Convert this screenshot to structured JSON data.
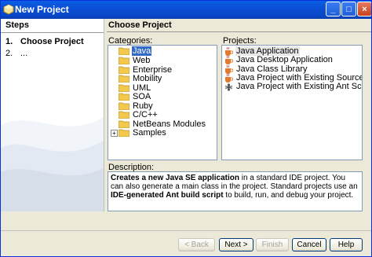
{
  "window": {
    "title": "New Project"
  },
  "steps": {
    "heading": "Steps",
    "items": [
      {
        "num": "1.",
        "label": "Choose Project"
      },
      {
        "num": "2.",
        "label": "..."
      }
    ]
  },
  "main": {
    "heading": "Choose Project",
    "categories_label": "Categories:",
    "projects_label": "Projects:",
    "categories": [
      {
        "label": "Java",
        "selected": true
      },
      {
        "label": "Web"
      },
      {
        "label": "Enterprise"
      },
      {
        "label": "Mobility"
      },
      {
        "label": "UML"
      },
      {
        "label": "SOA"
      },
      {
        "label": "Ruby"
      },
      {
        "label": "C/C++"
      },
      {
        "label": "NetBeans Modules"
      },
      {
        "label": "Samples",
        "expander": "+"
      }
    ],
    "projects": [
      {
        "label": "Java Application",
        "selected": true
      },
      {
        "label": "Java Desktop Application"
      },
      {
        "label": "Java Class Library"
      },
      {
        "label": "Java Project with Existing Sources"
      },
      {
        "label": "Java Project with Existing Ant Script"
      }
    ],
    "description_label": "Description:",
    "description": {
      "p1": "Creates a new Java SE application",
      "p2": " in a standard IDE project. You can also generate a main class in the project. Standard projects use an ",
      "p3": "IDE-generated Ant build script",
      "p4": " to build, run, and debug your project."
    }
  },
  "buttons": {
    "back": "< Back",
    "next": "Next >",
    "finish": "Finish",
    "cancel": "Cancel",
    "help": "Help"
  },
  "colors": {
    "titlebar": "#0a5fe6",
    "selection": "#316ac5",
    "folder": "#f2c94c"
  }
}
